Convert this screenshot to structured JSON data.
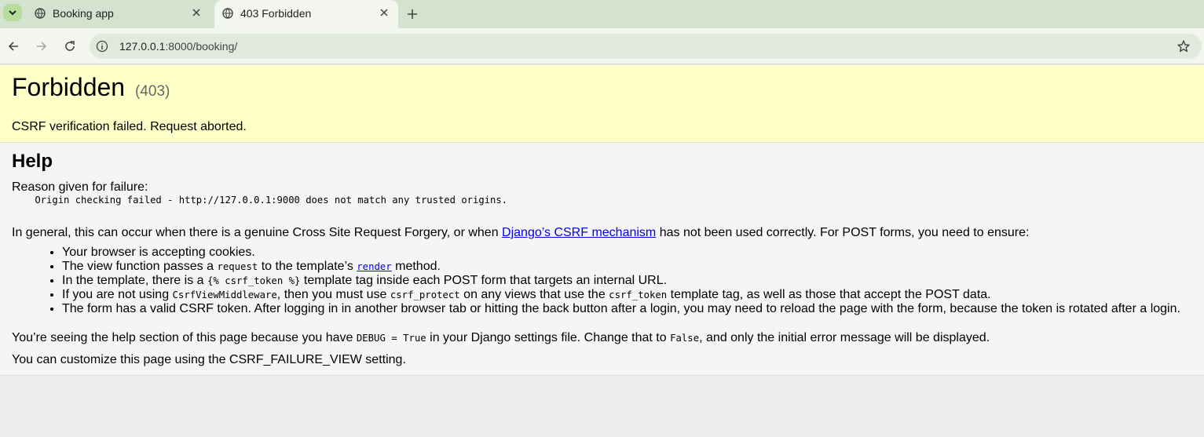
{
  "browser": {
    "tabs": [
      {
        "title": "Booking app",
        "active": false
      },
      {
        "title": "403 Forbidden",
        "active": true
      }
    ],
    "url_host": "127.0.0.1",
    "url_path": ":8000/booking/"
  },
  "summary": {
    "title": "Forbidden",
    "code": "(403)",
    "message": "CSRF verification failed. Request aborted."
  },
  "help": {
    "heading": "Help",
    "reason_label": "Reason given for failure:",
    "reason": "    Origin checking failed - http://127.0.0.1:9000 does not match any trusted origins.",
    "general_pre": "In general, this can occur when there is a genuine Cross Site Request Forgery, or when ",
    "general_link": "Django’s CSRF mechanism",
    "general_post": " has not been used correctly. For POST forms, you need to ensure:",
    "items": {
      "i1": "Your browser is accepting cookies.",
      "i2_a": "The view function passes a ",
      "i2_code": "request",
      "i2_b": " to the template’s ",
      "i2_link": "render",
      "i2_c": " method.",
      "i3_a": "In the template, there is a ",
      "i3_code": "{% csrf_token %}",
      "i3_b": " template tag inside each POST form that targets an internal URL.",
      "i4_a": "If you are not using ",
      "i4_code1": "CsrfViewMiddleware",
      "i4_b": ", then you must use ",
      "i4_code2": "csrf_protect",
      "i4_c": " on any views that use the ",
      "i4_code3": "csrf_token",
      "i4_d": " template tag, as well as those that accept the POST data.",
      "i5": "The form has a valid CSRF token. After logging in in another browser tab or hitting the back button after a login, you may need to reload the page with the form, because the token is rotated after a login."
    },
    "debug_a": "You’re seeing the help section of this page because you have ",
    "debug_code1": "DEBUG = True",
    "debug_b": " in your Django settings file. Change that to ",
    "debug_code2": "False",
    "debug_c": ", and only the initial error message will be displayed.",
    "custom": "You can customize this page using the CSRF_FAILURE_VIEW setting."
  }
}
